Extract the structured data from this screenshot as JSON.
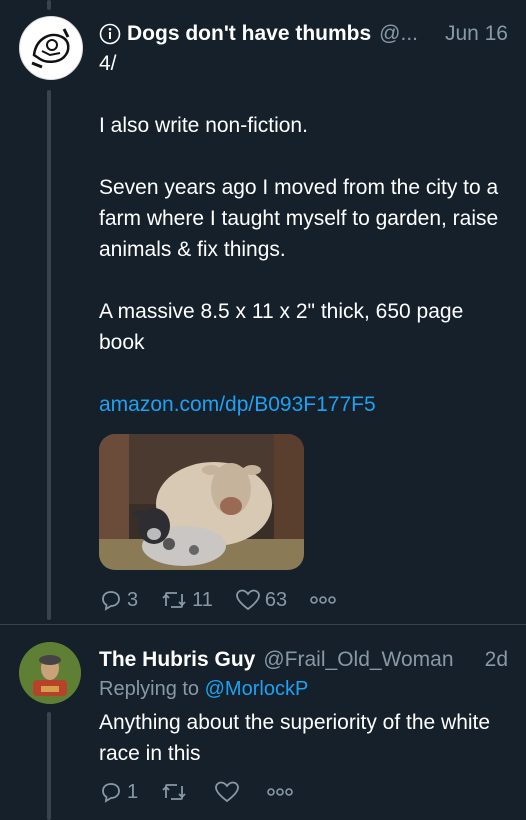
{
  "tweets": [
    {
      "author_name": "Dogs don't have thumbs",
      "handle": "@...",
      "time": "Jun 16",
      "body": [
        "4/",
        "",
        "I also write non-fiction.",
        "",
        "Seven years ago I moved from the city to a farm where I taught myself to garden, raise animals & fix things.",
        "",
        "A massive 8.5 x 11 x 2\" thick, 650 page book"
      ],
      "link": "amazon.com/dp/B093F177F5",
      "media_icon": "sheep-and-lamb-photo",
      "actions": {
        "replies": "3",
        "retweets": "11",
        "likes": "63"
      }
    },
    {
      "author_name": "The Hubris Guy",
      "handle": "@Frail_Old_Woman",
      "time": "2d",
      "replying_prefix": "Replying to",
      "replying_to": "@MorlockP",
      "body": "Anything about the superiority of the white race in this",
      "actions": {
        "replies": "1",
        "retweets": "",
        "likes": ""
      }
    }
  ],
  "colors": {
    "background": "#15202b",
    "secondary_text": "#8899a6",
    "link": "#1da1f2",
    "thread_line": "#38444d"
  }
}
